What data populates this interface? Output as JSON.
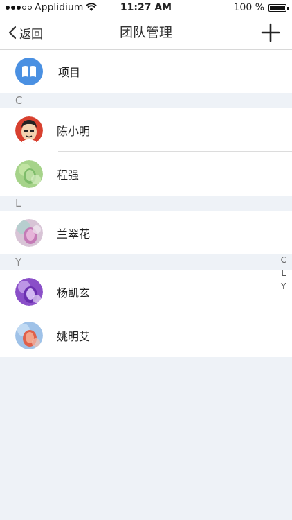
{
  "status_bar": {
    "carrier": "Applidium",
    "time": "11:27 AM",
    "battery": "100 %"
  },
  "nav": {
    "back_label": "返回",
    "title": "团队管理"
  },
  "project_row": {
    "label": "项目",
    "icon": "book-icon",
    "icon_color": "#4a90e2"
  },
  "sections": [
    {
      "letter": "C",
      "members": [
        {
          "name": "陈小明"
        },
        {
          "name": "程强"
        }
      ]
    },
    {
      "letter": "L",
      "members": [
        {
          "name": "兰翠花"
        }
      ]
    },
    {
      "letter": "Y",
      "members": [
        {
          "name": "杨凯玄"
        },
        {
          "name": "姚明艾"
        }
      ]
    }
  ],
  "index_letters": [
    "C",
    "L",
    "Y"
  ]
}
